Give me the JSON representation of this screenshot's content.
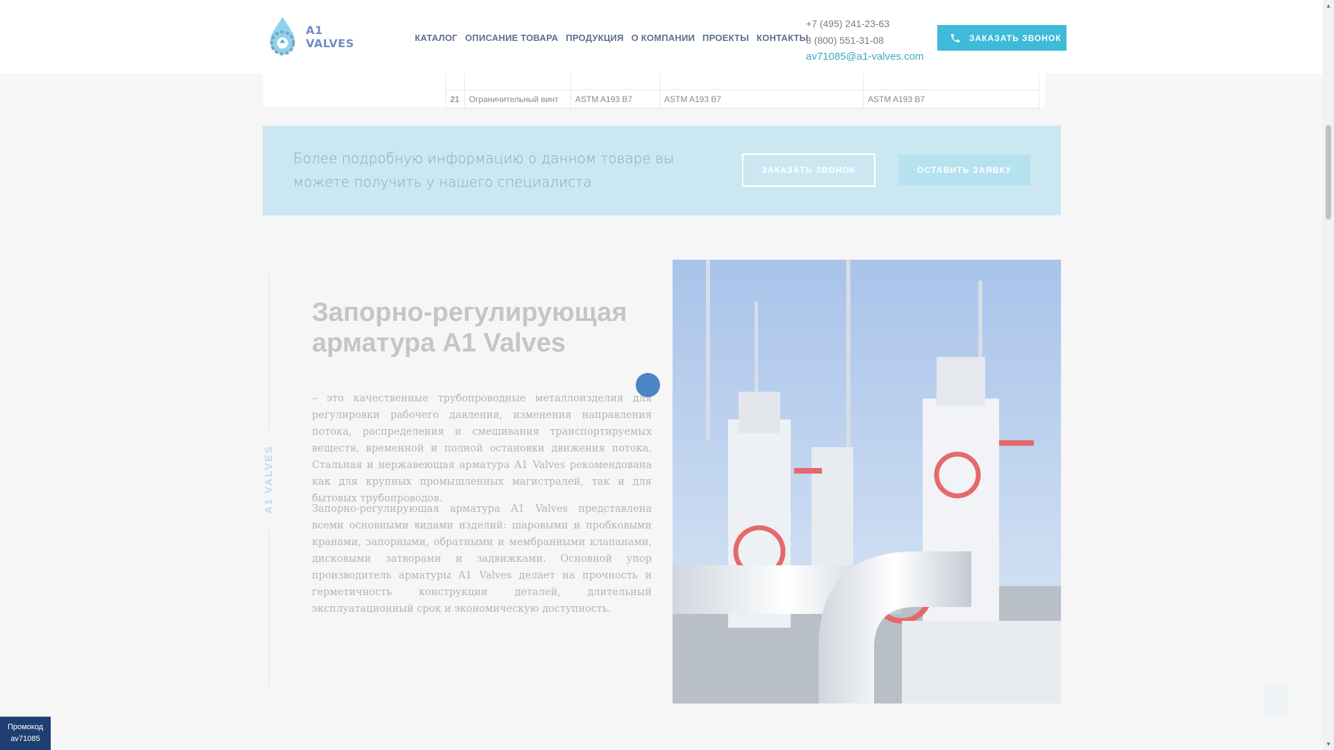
{
  "header": {
    "logo_text": "A1 VALVES",
    "nav": [
      "КАТАЛОГ",
      "ОПИСАНИЕ ТОВАРА",
      "ПРОДУКЦИЯ",
      "О КОМПАНИИ",
      "ПРОЕКТЫ",
      "КОНТАКТЫ"
    ],
    "phone1": "+7 (495) 241-23-63",
    "phone2": "8 (800) 551-31-08",
    "email": "av71085@a1-valves.com",
    "call_button": "ЗАКАЗАТЬ ЗВОНОК"
  },
  "table_row": {
    "num": "21",
    "name": "Ограничительный винт",
    "col2": "ASTM A193 B7",
    "col3": "ASTM A193 B7",
    "col4": "ASTM A193 B7"
  },
  "banner": {
    "text": "Более подробную информацию о данном товаре вы можете получить у нашего специалиста",
    "call_button": "ЗАКАЗАТЬ ЗВОНОК",
    "request_button": "ОСТАВИТЬ ЗАЯВКУ"
  },
  "content": {
    "side_label": "A1 VALVES",
    "title": "Запорно-регулирующая арматура A1 Valves",
    "paragraph1": "– это качественные трубопроводные металлоизделия для регулировки рабочего давления, изменения направления потока, распределения и смешивания транспортируемых веществ, временной и полной остановки движения потока. Стальная и нержавеющая арматура A1 Valves рекомендована как для крупных промышленных магистралей, так и для бытовых трубопроводов.",
    "paragraph2": "Запорно-регулирующая арматура A1 Valves представлена всеми основными видами изделий: шаровыми и пробковыми кранами, запорными, обратными и мембранными клапанами, дисковыми затворами и задвижками. Основной упор производитель арматуры A1 Valves делает на прочность и герметичность конструкции деталей, длительный эксплуатационный срок и экономическую доступность."
  },
  "promo": {
    "label": "Промокод",
    "code": "av71085"
  },
  "colors": {
    "accent": "#3ebbd9",
    "banner_bg": "#cbe8f2",
    "promo_bg": "#1e3f72",
    "dot": "#4a86c5"
  }
}
